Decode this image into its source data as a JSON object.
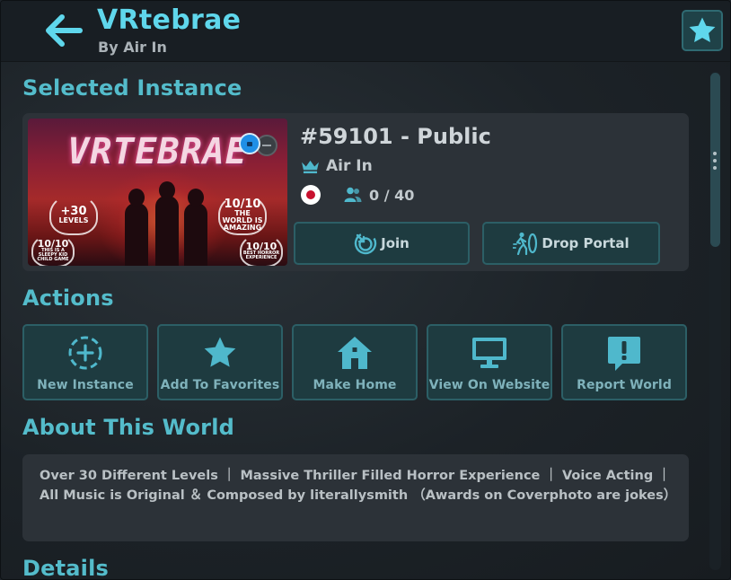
{
  "header": {
    "title": "VRtebrae",
    "author": "By Air In"
  },
  "sections": {
    "selected_instance": "Selected Instance",
    "actions": "Actions",
    "about": "About This World",
    "details": "Details"
  },
  "instance": {
    "name": "#59101 - Public",
    "owner": "Air In",
    "region": "japan-flag",
    "users": "0 / 40",
    "join_label": "Join",
    "portal_label": "Drop Portal",
    "thumbnail": {
      "logo": "VRTEBRAE",
      "awards": [
        {
          "top": "+30",
          "bottom": "LEVELS"
        },
        {
          "top": "10/10",
          "bottom": "THE WORLD IS AMAZING"
        },
        {
          "top": "10/10",
          "bottom": "THIS IS A SLEEPY KID CHILD GAME"
        },
        {
          "top": "10/10",
          "bottom": "BEST HORROR EXPERIENCE"
        }
      ]
    }
  },
  "actions": [
    {
      "label": "New Instance",
      "icon": "new-instance-icon"
    },
    {
      "label": "Add To Favorites",
      "icon": "star-icon"
    },
    {
      "label": "Make Home",
      "icon": "home-icon"
    },
    {
      "label": "View On Website",
      "icon": "monitor-icon"
    },
    {
      "label": "Report World",
      "icon": "report-icon"
    }
  ],
  "about_text": "Over 30 Different Levels ｜ Massive Thriller Filled Horror Experience ｜ Voice Acting ｜All Music is Original ＆ Composed by literallysmith （Awards on Coverphoto are jokes）",
  "colors": {
    "accent": "#5fd7ec",
    "section_heading": "#54bccb",
    "button_bg": "#1e3b40",
    "button_border": "#2c5f66",
    "card_bg": "#2c3238"
  }
}
